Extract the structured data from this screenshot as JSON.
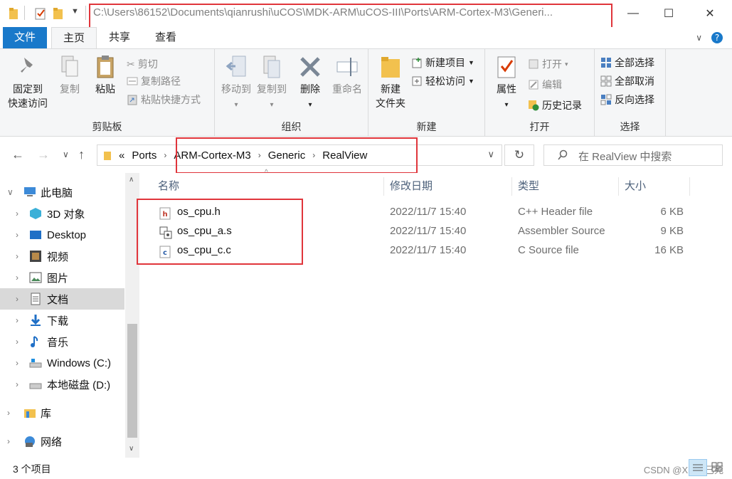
{
  "title_bar": {
    "path": "C:\\Users\\86152\\Documents\\qianrushi\\uCOS\\MDK-ARM\\uCOS-III\\Ports\\ARM-Cortex-M3\\Generi...",
    "minimize": "—",
    "maximize": "☐",
    "close": "✕",
    "highlight_color": "#e0353b"
  },
  "ribbon_tabs": [
    {
      "label": "文件"
    },
    {
      "label": "主页"
    },
    {
      "label": "共享"
    },
    {
      "label": "查看"
    }
  ],
  "ribbon": {
    "clipboard": {
      "group_label": "剪贴板",
      "pin_label_1": "固定到",
      "pin_label_2": "快速访问",
      "copy": "复制",
      "paste": "粘贴",
      "cut": "剪切",
      "copy_path": "复制路径",
      "paste_shortcut": "粘贴快捷方式"
    },
    "organize": {
      "group_label": "组织",
      "move_to": "移动到",
      "copy_to": "复制到",
      "delete": "删除",
      "rename": "重命名"
    },
    "new": {
      "group_label": "新建",
      "new_folder_1": "新建",
      "new_folder_2": "文件夹",
      "new_item": "新建项目",
      "easy_access": "轻松访问"
    },
    "open": {
      "group_label": "打开",
      "properties": "属性",
      "open": "打开",
      "edit": "编辑",
      "history": "历史记录"
    },
    "select": {
      "group_label": "选择",
      "select_all": "全部选择",
      "select_none": "全部取消",
      "invert": "反向选择"
    }
  },
  "address_bar": {
    "segments": [
      "Ports",
      "ARM-Cortex-M3",
      "Generic",
      "RealView"
    ],
    "overflow": "«",
    "search_placeholder": "在 RealView 中搜索"
  },
  "nav_tree": [
    {
      "label": "此电脑",
      "icon": "pc-icon",
      "expanded": true
    },
    {
      "label": "3D 对象",
      "icon": "3d-objects-icon"
    },
    {
      "label": "Desktop",
      "icon": "desktop-icon"
    },
    {
      "label": "视频",
      "icon": "video-icon"
    },
    {
      "label": "图片",
      "icon": "pictures-icon"
    },
    {
      "label": "文档",
      "icon": "documents-icon",
      "selected": true
    },
    {
      "label": "下载",
      "icon": "download-icon"
    },
    {
      "label": "音乐",
      "icon": "music-icon"
    },
    {
      "label": "Windows (C:)",
      "icon": "drive-c-icon"
    },
    {
      "label": "本地磁盘 (D:)",
      "icon": "drive-d-icon"
    },
    {
      "label": "库",
      "icon": "library-icon"
    },
    {
      "label": "网络",
      "icon": "network-icon"
    }
  ],
  "columns": {
    "name": "名称",
    "date": "修改日期",
    "type": "类型",
    "size": "大小"
  },
  "files": [
    {
      "name": "os_cpu.h",
      "date": "2022/11/7 15:40",
      "type": "C++ Header file",
      "size": "6 KB",
      "icon": "header-file-icon"
    },
    {
      "name": "os_cpu_a.s",
      "date": "2022/11/7 15:40",
      "type": "Assembler Source",
      "size": "9 KB",
      "icon": "assembler-file-icon"
    },
    {
      "name": "os_cpu_c.c",
      "date": "2022/11/7 15:40",
      "type": "C Source file",
      "size": "16 KB",
      "icon": "c-file-icon"
    }
  ],
  "status": {
    "count": "3 个项目",
    "watermark": "CSDN @Xicun已死"
  }
}
